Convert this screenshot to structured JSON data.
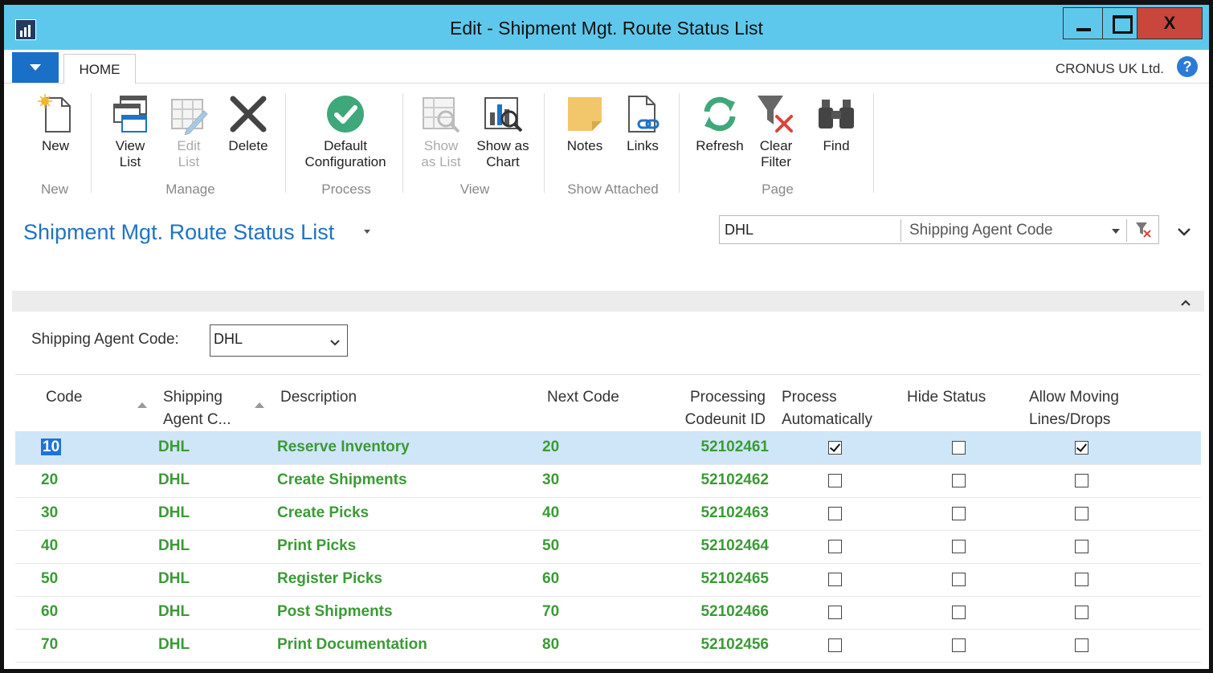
{
  "window": {
    "title": "Edit - Shipment Mgt. Route Status List",
    "close_label": "X"
  },
  "ribbon": {
    "tab": "HOME",
    "company": "CRONUS UK Ltd.",
    "help_label": "?",
    "buttons": {
      "new": "New",
      "view_list": [
        "View",
        "List"
      ],
      "edit_list": [
        "Edit",
        "List"
      ],
      "delete": "Delete",
      "default_config": [
        "Default",
        "Configuration"
      ],
      "show_as_list": [
        "Show",
        "as List"
      ],
      "show_as_chart": [
        "Show as",
        "Chart"
      ],
      "notes": "Notes",
      "links": "Links",
      "refresh": "Refresh",
      "clear_filter": [
        "Clear",
        "Filter"
      ],
      "find": "Find"
    },
    "groups": {
      "new": "New",
      "manage": "Manage",
      "process": "Process",
      "view": "View",
      "show_attached": "Show Attached",
      "page": "Page"
    }
  },
  "page": {
    "title": "Shipment Mgt. Route Status List",
    "search_value": "DHL",
    "search_field": "Shipping Agent Code"
  },
  "filter": {
    "label": "Shipping Agent Code:",
    "value": "DHL"
  },
  "table": {
    "headers": {
      "code": "Code",
      "agent": [
        "Shipping",
        "Agent C..."
      ],
      "description": "Description",
      "next_code": "Next Code",
      "codeunit": [
        "Processing",
        "Codeunit ID"
      ],
      "process_auto": [
        "Process",
        "Automatically"
      ],
      "hide_status": "Hide Status",
      "allow_moving": [
        "Allow Moving",
        "Lines/Drops"
      ]
    },
    "rows": [
      {
        "code": "10",
        "agent": "DHL",
        "description": "Reserve Inventory",
        "next_code": "20",
        "codeunit": "52102461",
        "process_auto": true,
        "hide_status": false,
        "allow_moving": true
      },
      {
        "code": "20",
        "agent": "DHL",
        "description": "Create Shipments",
        "next_code": "30",
        "codeunit": "52102462",
        "process_auto": false,
        "hide_status": false,
        "allow_moving": false
      },
      {
        "code": "30",
        "agent": "DHL",
        "description": "Create Picks",
        "next_code": "40",
        "codeunit": "52102463",
        "process_auto": false,
        "hide_status": false,
        "allow_moving": false
      },
      {
        "code": "40",
        "agent": "DHL",
        "description": "Print Picks",
        "next_code": "50",
        "codeunit": "52102464",
        "process_auto": false,
        "hide_status": false,
        "allow_moving": false
      },
      {
        "code": "50",
        "agent": "DHL",
        "description": "Register Picks",
        "next_code": "60",
        "codeunit": "52102465",
        "process_auto": false,
        "hide_status": false,
        "allow_moving": false
      },
      {
        "code": "60",
        "agent": "DHL",
        "description": "Post Shipments",
        "next_code": "70",
        "codeunit": "52102466",
        "process_auto": false,
        "hide_status": false,
        "allow_moving": false
      },
      {
        "code": "70",
        "agent": "DHL",
        "description": "Print Documentation",
        "next_code": "80",
        "codeunit": "52102456",
        "process_auto": false,
        "hide_status": false,
        "allow_moving": false
      }
    ]
  },
  "colors": {
    "titlebar": "#5ec8ec",
    "accent": "#1f73c4",
    "row_text": "#3a9b35",
    "selected_row": "#cfe6f8"
  }
}
